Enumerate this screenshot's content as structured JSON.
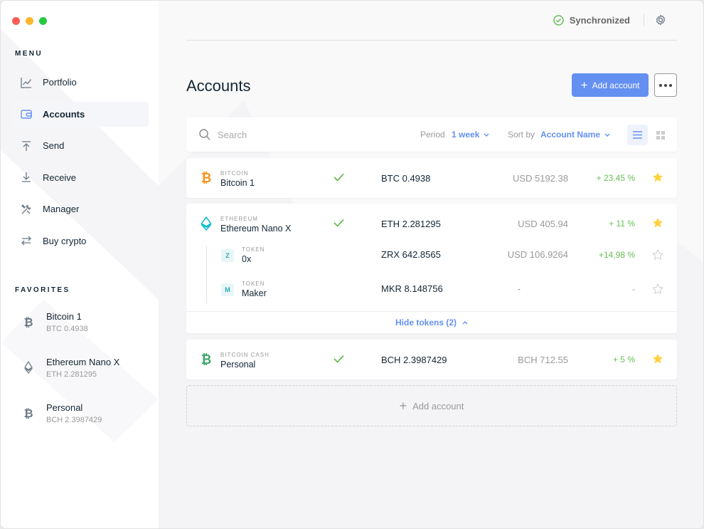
{
  "colors": {
    "accent": "#6490f1",
    "positive": "#66be54",
    "bitcoin": "#f7931a",
    "ethereum": "#0ebdcd",
    "bitcoin_cash": "#3ca569",
    "star": "#ffd13b"
  },
  "sidebar": {
    "menu_title": "MENU",
    "items": [
      {
        "label": "Portfolio",
        "icon": "chart-line-icon"
      },
      {
        "label": "Accounts",
        "icon": "wallet-icon"
      },
      {
        "label": "Send",
        "icon": "arrow-up-icon"
      },
      {
        "label": "Receive",
        "icon": "arrow-down-icon"
      },
      {
        "label": "Manager",
        "icon": "tools-icon"
      },
      {
        "label": "Buy crypto",
        "icon": "exchange-icon"
      }
    ],
    "active_index": 1,
    "favorites_title": "FAVORITES",
    "favorites": [
      {
        "name": "Bitcoin 1",
        "balance": "BTC 0.4938",
        "icon": "bitcoin-icon"
      },
      {
        "name": "Ethereum Nano X",
        "balance": "ETH 2.281295",
        "icon": "ethereum-icon"
      },
      {
        "name": "Personal",
        "balance": "BCH 2.3987429",
        "icon": "bitcoin-icon"
      }
    ]
  },
  "topbar": {
    "sync_status": "Synchronized"
  },
  "header": {
    "title": "Accounts",
    "add_account_label": "Add account"
  },
  "toolbar": {
    "search_placeholder": "Search",
    "period_label": "Period",
    "period_value": "1 week",
    "sort_label": "Sort by",
    "sort_value": "Account Name"
  },
  "accounts": [
    {
      "type": "BITCOIN",
      "name": "Bitcoin 1",
      "balance": "BTC 0.4938",
      "fiat": "USD 5192.38",
      "change": "+ 23.45 %",
      "starred": true,
      "synced": true,
      "icon": "bitcoin-icon"
    },
    {
      "type": "ETHEREUM",
      "name": "Ethereum Nano X",
      "balance": "ETH 2.281295",
      "fiat": "USD 405.94",
      "change": "+ 11 %",
      "starred": true,
      "synced": true,
      "icon": "ethereum-icon",
      "tokens": [
        {
          "badge": "Z",
          "type": "TOKEN",
          "name": "0x",
          "balance": "ZRX 642.8565",
          "fiat": "USD 106.9264",
          "change": "+14,98 %",
          "starred": false
        },
        {
          "badge": "M",
          "type": "TOKEN",
          "name": "Maker",
          "balance": "MKR 8.148756",
          "fiat": "-",
          "change": "-",
          "starred": false
        }
      ],
      "hide_tokens_label": "Hide tokens (2)"
    },
    {
      "type": "BITCOIN CASH",
      "name": "Personal",
      "balance": "BCH 2.3987429",
      "fiat": "BCH 712.55",
      "change": "+ 5 %",
      "starred": true,
      "synced": true,
      "icon": "bitcoin-icon"
    }
  ],
  "add_account_dashed_label": "Add account"
}
